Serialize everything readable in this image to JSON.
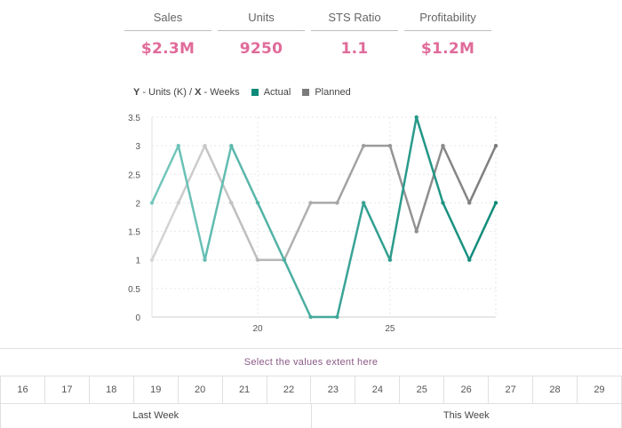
{
  "kpis": [
    {
      "label": "Sales",
      "value": "$2.3M"
    },
    {
      "label": "Units",
      "value": "9250"
    },
    {
      "label": "STS Ratio",
      "value": "1.1"
    },
    {
      "label": "Profitability",
      "value": "$1.2M"
    }
  ],
  "legend": {
    "axes_prefix": "Y",
    "axes_middle": " - Units (K) / ",
    "axes_x": "X",
    "axes_suffix": " - Weeks",
    "actual": "Actual",
    "planned": "Planned"
  },
  "colors": {
    "accent": "#e06b9a",
    "actual": "#0e8a78",
    "planned": "#7b7b7b"
  },
  "chart_data": {
    "type": "line",
    "xlabel": "Weeks",
    "ylabel": "Units (K)",
    "xlim": [
      16,
      29
    ],
    "ylim": [
      0,
      3.5
    ],
    "x_ticks": [
      20,
      25
    ],
    "y_ticks": [
      0,
      0.5,
      1,
      1.5,
      2,
      2.5,
      3,
      3.5
    ],
    "y_tick_labels": [
      "0",
      "0.5",
      "1",
      "1.5",
      "2",
      "2.5",
      "3",
      "3.5"
    ],
    "x": [
      16,
      17,
      18,
      19,
      20,
      21,
      22,
      23,
      24,
      25,
      26,
      27,
      28,
      29
    ],
    "series": [
      {
        "name": "Actual",
        "values": [
          2,
          3,
          1,
          3,
          2,
          1,
          0,
          0,
          2,
          1,
          3.5,
          2,
          1,
          2
        ]
      },
      {
        "name": "Planned",
        "values": [
          1,
          2,
          3,
          2,
          1,
          1,
          2,
          2,
          3,
          3,
          1.5,
          3,
          2,
          3
        ]
      }
    ],
    "grid": true
  },
  "brush": {
    "title": "Select the values extent here",
    "weeks": [
      "16",
      "17",
      "18",
      "19",
      "20",
      "21",
      "22",
      "23",
      "24",
      "25",
      "26",
      "27",
      "28",
      "29"
    ],
    "periods": [
      "Last Week",
      "This Week"
    ]
  }
}
